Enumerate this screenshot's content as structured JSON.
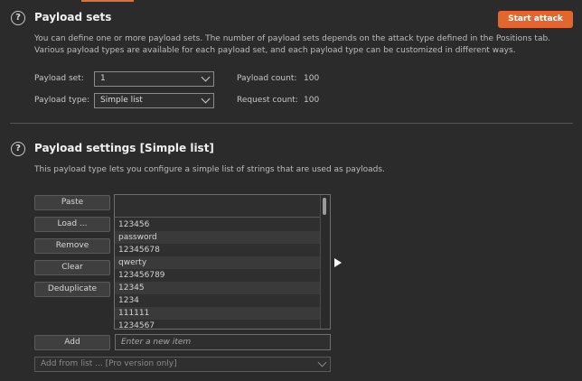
{
  "payload_sets": {
    "title": "Payload sets",
    "start_attack_label": "Start attack",
    "desc_line1": "You can define one or more payload sets. The number of payload sets depends on the attack type defined in the Positions tab.",
    "desc_line2": "Various payload types are available for each payload set, and each payload type can be customized in different ways.",
    "set_label": "Payload set:",
    "set_value": "1",
    "type_label": "Payload type:",
    "type_value": "Simple list",
    "count_label": "Payload count:",
    "count_value": "100",
    "request_label": "Request count:",
    "request_value": "100"
  },
  "payload_settings": {
    "title": "Payload settings [Simple list]",
    "desc": "This payload type lets you configure a simple list of strings that are used as payloads.",
    "buttons": {
      "paste": "Paste",
      "load": "Load ...",
      "remove": "Remove",
      "clear": "Clear",
      "deduplicate": "Deduplicate",
      "add": "Add"
    },
    "items": [
      "123456",
      "password",
      "12345678",
      "qwerty",
      "123456789",
      "12345",
      "1234",
      "111111",
      "1234567"
    ],
    "new_item_placeholder": "Enter a new item",
    "add_from_list": "Add from list ... [Pro version only]"
  },
  "icons": {
    "help": "?"
  },
  "colors": {
    "accent": "#e2672e"
  }
}
